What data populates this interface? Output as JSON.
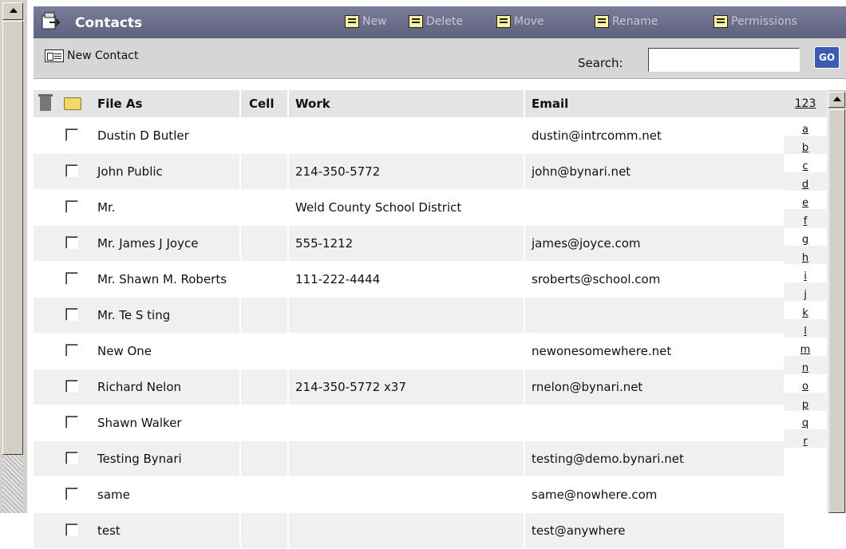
{
  "header": {
    "title": "Contacts",
    "actions": [
      {
        "label": "New",
        "icon": "new-folder-icon"
      },
      {
        "label": "Delete",
        "icon": "delete-folder-icon"
      },
      {
        "label": "Move",
        "icon": "move-folder-icon"
      },
      {
        "label": "Rename",
        "icon": "rename-folder-icon"
      },
      {
        "label": "Permissions",
        "icon": "permissions-icon"
      }
    ]
  },
  "toolbar": {
    "new_contact_label": "New Contact",
    "search_label": "Search:",
    "search_value": "",
    "go_label": "GO"
  },
  "table": {
    "columns": [
      "File As",
      "Cell",
      "Work",
      "Email"
    ],
    "rows": [
      {
        "file_as": "Dustin D Butler",
        "cell": "",
        "work": "",
        "email": "dustin@intrcomm.net"
      },
      {
        "file_as": "John Public",
        "cell": "",
        "work": "214-350-5772",
        "email": "john@bynari.net"
      },
      {
        "file_as": "Mr.",
        "cell": "",
        "work": "Weld County School District",
        "email": ""
      },
      {
        "file_as": "Mr. James J Joyce",
        "cell": "",
        "work": "555-1212",
        "email": "james@joyce.com"
      },
      {
        "file_as": "Mr. Shawn M. Roberts",
        "cell": "",
        "work": "111-222-4444",
        "email": "sroberts@school.com"
      },
      {
        "file_as": "Mr. Te S ting",
        "cell": "",
        "work": "",
        "email": ""
      },
      {
        "file_as": "New One",
        "cell": "",
        "work": "",
        "email": "newonesomewhere.net"
      },
      {
        "file_as": "Richard Nelon",
        "cell": "",
        "work": "214-350-5772 x37",
        "email": "rnelon@bynari.net"
      },
      {
        "file_as": "Shawn Walker",
        "cell": "",
        "work": "",
        "email": ""
      },
      {
        "file_as": "Testing Bynari",
        "cell": "",
        "work": "",
        "email": "testing@demo.bynari.net"
      },
      {
        "file_as": "same",
        "cell": "",
        "work": "",
        "email": "same@nowhere.com"
      },
      {
        "file_as": "test",
        "cell": "",
        "work": "",
        "email": "test@anywhere"
      }
    ]
  },
  "letter_index": [
    "123",
    "a",
    "b",
    "c",
    "d",
    "e",
    "f",
    "g",
    "h",
    "i",
    "j",
    "k",
    "l",
    "m",
    "n",
    "o",
    "p",
    "q",
    "r"
  ]
}
